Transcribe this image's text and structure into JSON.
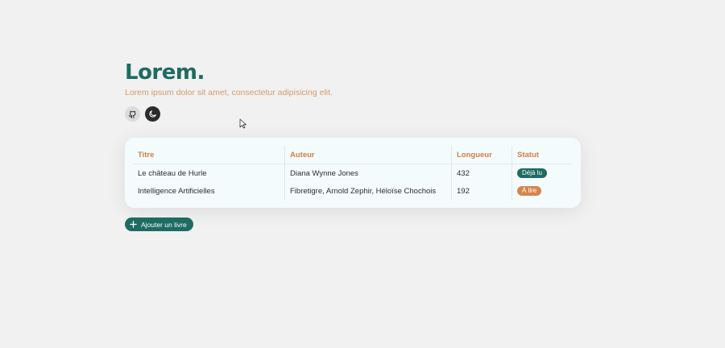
{
  "header": {
    "title": "Lorem.",
    "subtitle": "Lorem ipsum dolor sit amet, consectetur adipisicing elit."
  },
  "icons": {
    "github": "github-icon",
    "theme": "moon-icon",
    "add": "plus-icon"
  },
  "table": {
    "headers": [
      "Titre",
      "Auteur",
      "Longueur",
      "Statut"
    ],
    "rows": [
      {
        "title": "Le château de Hurle",
        "author": "Diana Wynne Jones",
        "length": "432",
        "status": "Déjà lu",
        "status_color": "#1e6b61"
      },
      {
        "title": "Intelligence Artificielles",
        "author": "Fibretigre, Arnold Zephir, Héloïse Chochois",
        "length": "192",
        "status": "À lire",
        "status_color": "#d4864e"
      }
    ]
  },
  "actions": {
    "add_label": "Ajouter un livre"
  },
  "colors": {
    "accent": "#1e6b61",
    "secondary": "#d07f47"
  }
}
